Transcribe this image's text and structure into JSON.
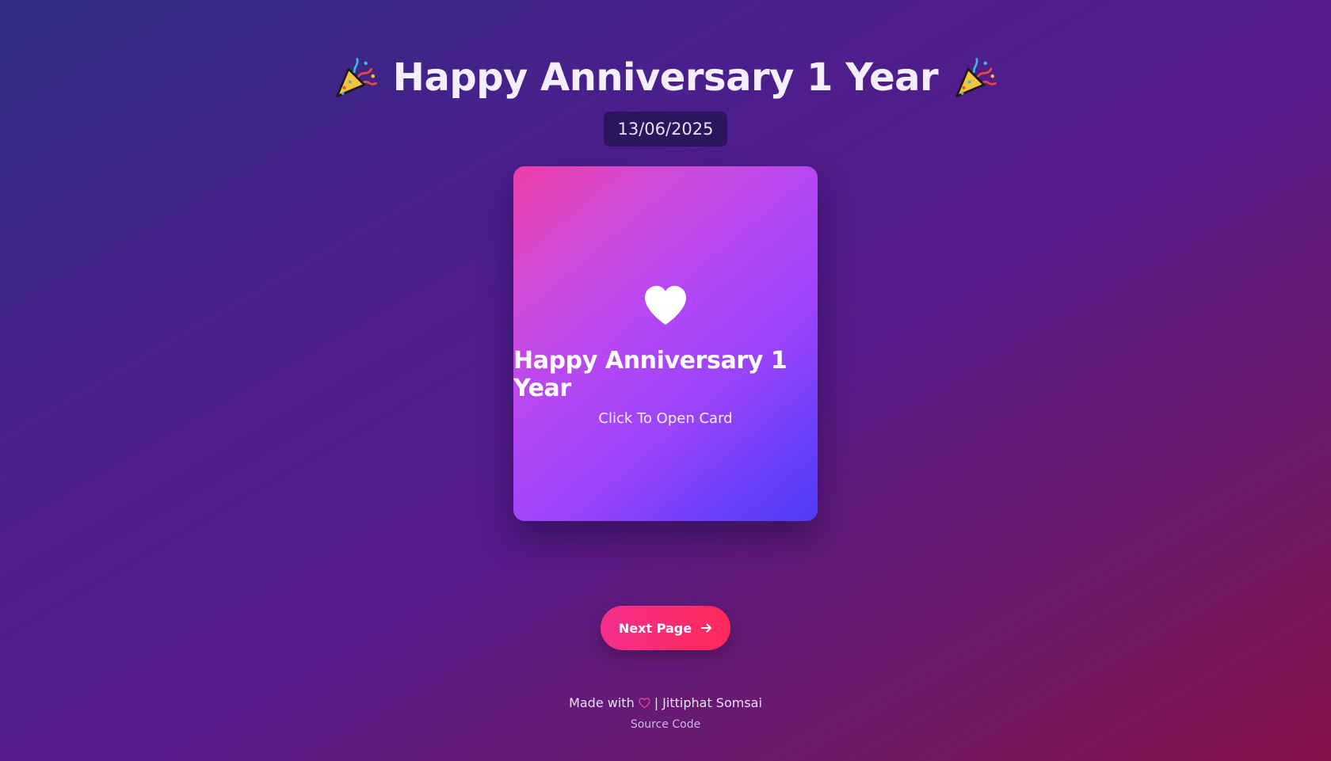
{
  "header": {
    "title": "Happy Anniversary 1 Year",
    "date": "13/06/2025",
    "left_icon": "party-popper-icon",
    "right_icon": "party-popper-icon"
  },
  "card": {
    "icon": "heart-icon",
    "title": "Happy Anniversary 1 Year",
    "subtitle": "Click To Open Card"
  },
  "navigation": {
    "next_label": "Next Page",
    "next_icon": "arrow-right-icon"
  },
  "footer": {
    "made_with_prefix": "Made with",
    "heart_icon": "heart-outline-icon",
    "author_text": "| Jittiphat Somsai",
    "source_label": "Source Code"
  },
  "colors": {
    "accent_pink": "#ff2a6d",
    "card_gradient_start": "#ee3da6",
    "card_gradient_end": "#4f3cf6"
  }
}
